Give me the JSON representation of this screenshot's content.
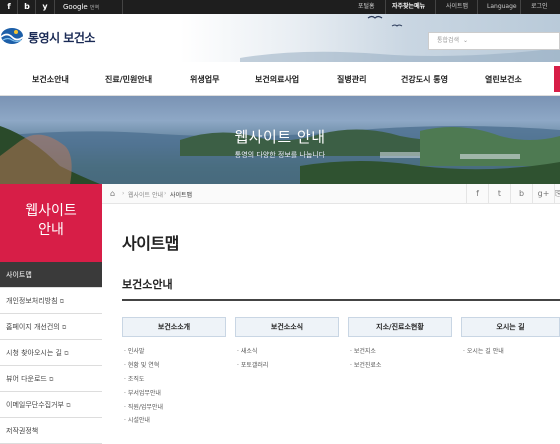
{
  "topbar": {
    "social": [
      "f",
      "b",
      "y"
    ],
    "google": "Google",
    "translate": "번역",
    "links": [
      "포털홈",
      "자주찾는메뉴",
      "사이트맵",
      "Language",
      "로그인"
    ]
  },
  "header": {
    "logo_text": "통영시 보건소",
    "search_placeholder": "통합검색"
  },
  "gnb": [
    "보건소안내",
    "진료/민원안내",
    "위생업무",
    "보건의료사업",
    "질병관리",
    "건강도시 통영",
    "열린보건소"
  ],
  "banner": {
    "title": "웹사이트 안내",
    "subtitle": "통영의 다양한 정보를 나눕니다"
  },
  "sidebar": {
    "title_line1": "웹사이트",
    "title_line2": "안내",
    "items": [
      {
        "label": "사이트맵"
      },
      {
        "label": "개인정보처리방침"
      },
      {
        "label": "홈페이지 개선건의"
      },
      {
        "label": "시청 찾아오시는 길"
      },
      {
        "label": "뷰어 다운로드"
      },
      {
        "label": "이메일무단수집거부"
      },
      {
        "label": "저작권정책"
      }
    ]
  },
  "breadcrumb": [
    "웹사이트 안내",
    "사이트맵"
  ],
  "share_icons": [
    "f",
    "t",
    "b",
    "g+",
    "⎘"
  ],
  "content": {
    "page_title": "사이트맵",
    "section_title": "보건소안내",
    "columns": [
      {
        "title": "보건소소개",
        "items": [
          "인사말",
          "현황 및 연혁",
          "조직도",
          "부서업무안내",
          "직원/업무안내",
          "시설안내"
        ]
      },
      {
        "title": "보건소소식",
        "items": [
          "새소식",
          "포토갤러리"
        ]
      },
      {
        "title": "지소/진료소현황",
        "items": [
          "보건지소",
          "보건진료소"
        ]
      },
      {
        "title": "오시는 길",
        "items": [
          "오시는 길 안내"
        ]
      }
    ]
  }
}
